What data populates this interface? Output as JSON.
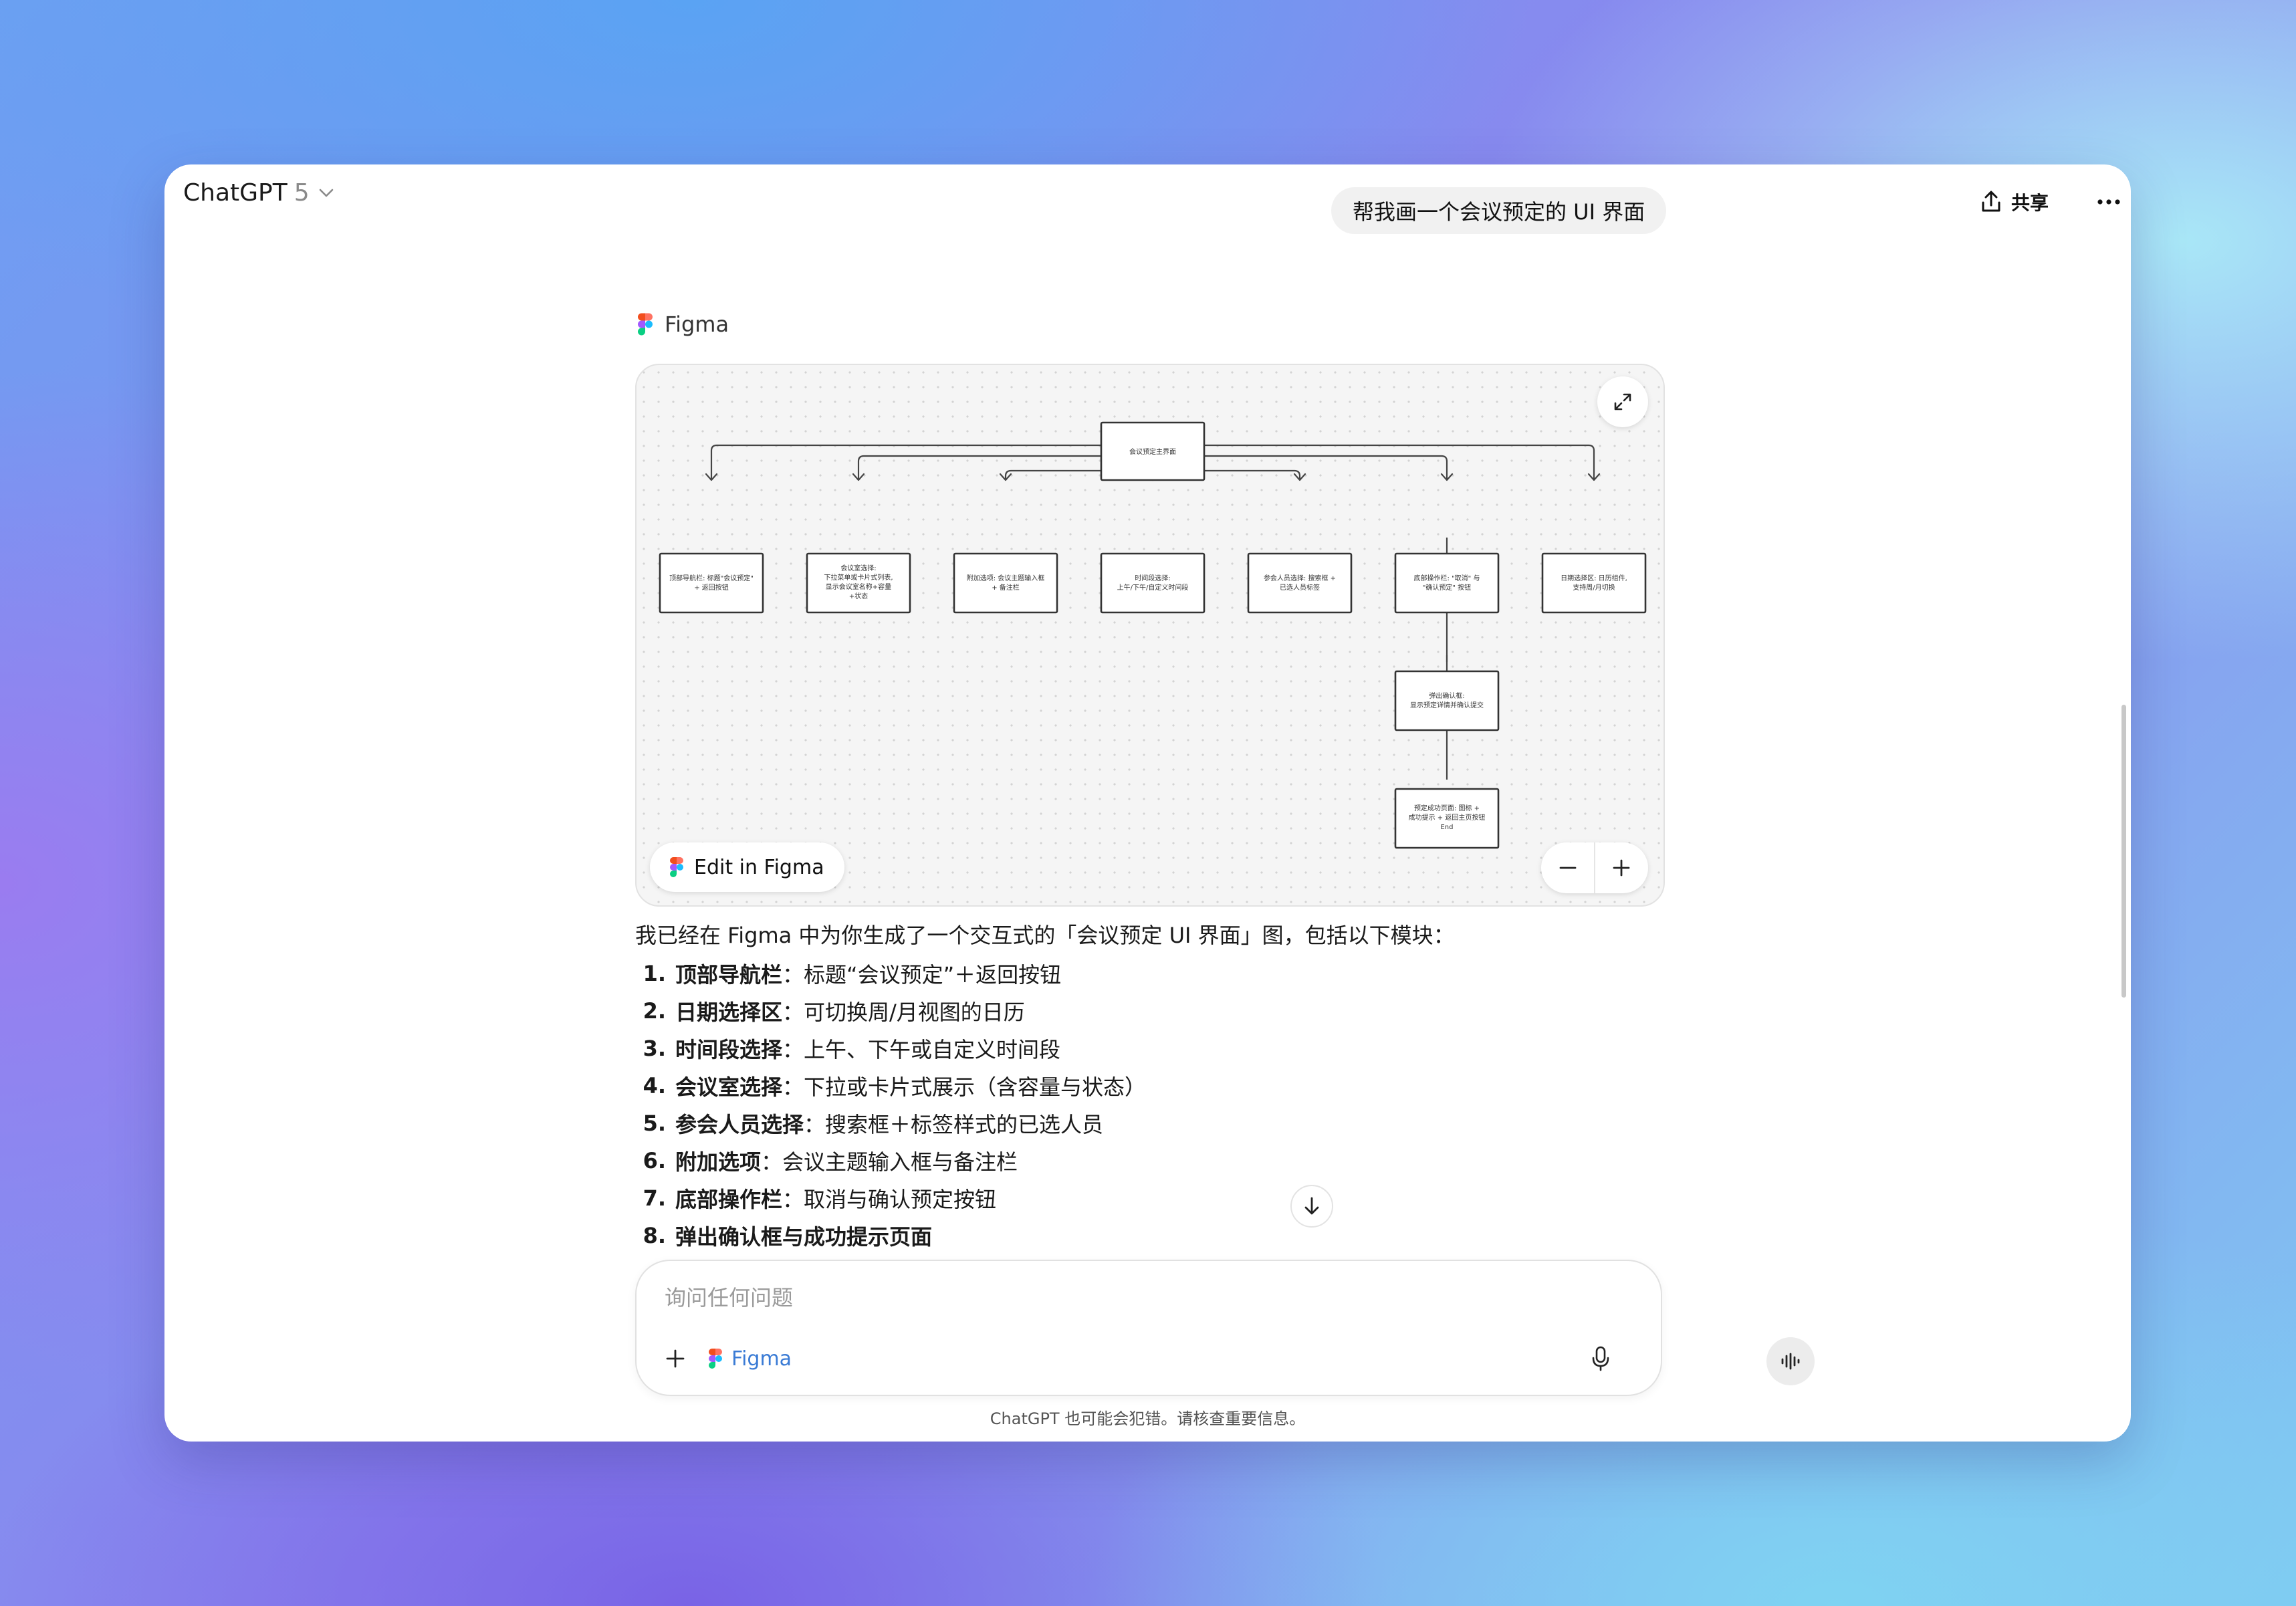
{
  "header": {
    "app_name": "ChatGPT",
    "model_version": "5",
    "share_label": "共享"
  },
  "user_message": "帮我画一个会议预定的 UI 界面",
  "tool": {
    "name": "Figma",
    "brand_colors": [
      "#f24e1e",
      "#ff7262",
      "#a259ff",
      "#1abcfe",
      "#0acf83"
    ]
  },
  "diagram": {
    "root": "会议预定主界面",
    "nodes": [
      [
        "顶部导航栏: 标题\"会议预定\"",
        "+ 返回按钮"
      ],
      [
        "会议室选择:",
        "下拉菜单或卡片式列表,",
        "显示会议室名称+容量",
        "+状态"
      ],
      [
        "附加选项: 会议主题输入框",
        "+ 备注栏"
      ],
      [
        "时间段选择:",
        "上午/下午/自定义时间段"
      ],
      [
        "参会人员选择: 搜索框 +",
        "已选人员标签"
      ],
      [
        "底部操作栏: \"取消\" 与",
        "\"确认预定\" 按钮"
      ],
      [
        "日期选择区: 日历组件,",
        "支持周/月切换"
      ]
    ],
    "confirm_node": [
      "弹出确认框:",
      "显示预定详情并确认提交"
    ],
    "success_node": [
      "预定成功页面: 图标 +",
      "成功提示 + 返回主页按钮",
      "End"
    ],
    "edit_label": "Edit in Figma"
  },
  "response": {
    "intro": "我已经在 Figma 中为你生成了一个交互式的「会议预定 UI 界面」图，包括以下模块：",
    "items": [
      {
        "num": "1.",
        "title": "顶部导航栏",
        "desc": "：标题“会议预定”＋返回按钮"
      },
      {
        "num": "2.",
        "title": "日期选择区",
        "desc": "：可切换周/月视图的日历"
      },
      {
        "num": "3.",
        "title": "时间段选择",
        "desc": "：上午、下午或自定义时间段"
      },
      {
        "num": "4.",
        "title": "会议室选择",
        "desc": "：下拉或卡片式展示（含容量与状态）"
      },
      {
        "num": "5.",
        "title": "参会人员选择",
        "desc": "：搜索框＋标签样式的已选人员"
      },
      {
        "num": "6.",
        "title": "附加选项",
        "desc": "：会议主题输入框与备注栏"
      },
      {
        "num": "7.",
        "title": "底部操作栏",
        "desc": "：取消与确认预定按钮"
      },
      {
        "num": "8.",
        "title": "弹出确认框",
        "desc": "与",
        "title2": "成功提示页面"
      }
    ]
  },
  "composer": {
    "placeholder": "询问任何问题",
    "tool_label": "Figma"
  },
  "disclaimer": "ChatGPT 也可能会犯错。请核查重要信息。"
}
